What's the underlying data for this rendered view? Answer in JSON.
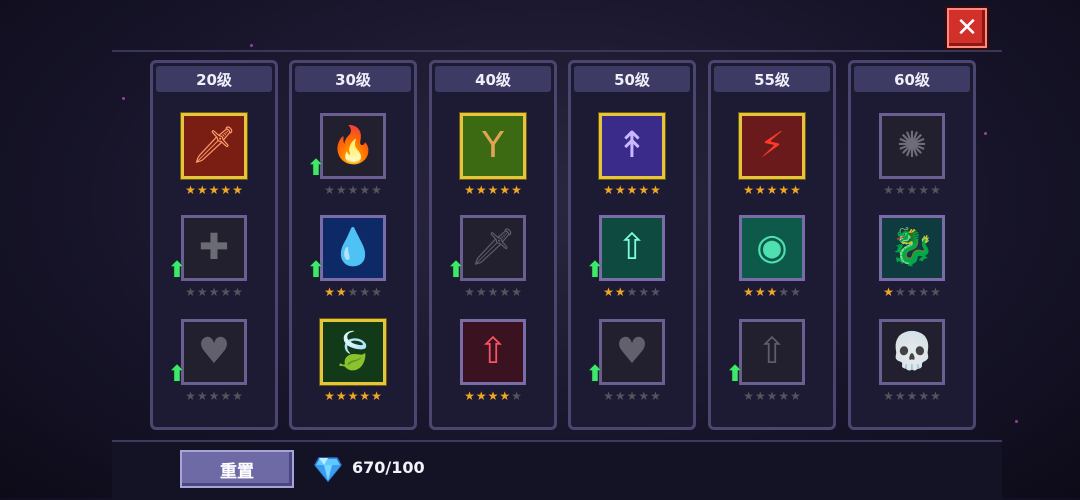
{
  "columns": [
    {
      "level": "20级",
      "skills": [
        {
          "icon": "sword-icon",
          "glyph": "🗡",
          "color": "#ff9a6a",
          "bg": "#7a1e14",
          "gold": true,
          "stars": 5,
          "up": false
        },
        {
          "icon": "shield-cross-icon",
          "glyph": "✚",
          "color": "#6b6b74",
          "bg": "#22202f",
          "gold": false,
          "stars": 0,
          "up": true
        },
        {
          "icon": "heart-icon",
          "glyph": "♥",
          "color": "#62606c",
          "bg": "#22202f",
          "gold": false,
          "stars": 0,
          "up": true
        }
      ]
    },
    {
      "level": "30级",
      "skills": [
        {
          "icon": "fire-drop-icon",
          "glyph": "🔥",
          "color": "#55535e",
          "bg": "#22202f",
          "gold": false,
          "stars": 0,
          "up": true
        },
        {
          "icon": "water-drop-icon",
          "glyph": "💧",
          "color": "#4aa8ff",
          "bg": "#0e2a66",
          "gold": false,
          "stars": 2,
          "up": true
        },
        {
          "icon": "leaf-icon",
          "glyph": "🍃",
          "color": "#47c95a",
          "bg": "#123a18",
          "gold": true,
          "stars": 5,
          "up": false
        }
      ]
    },
    {
      "level": "40级",
      "skills": [
        {
          "icon": "slingshot-icon",
          "glyph": "Y",
          "color": "#e0a457",
          "bg": "#3c6a12",
          "gold": true,
          "stars": 5,
          "up": false
        },
        {
          "icon": "dagger-icon",
          "glyph": "🗡",
          "color": "#5e5c68",
          "bg": "#22202f",
          "gold": false,
          "stars": 0,
          "up": true
        },
        {
          "icon": "crystal-sword-icon",
          "glyph": "⇧",
          "color": "#ff5060",
          "bg": "#3a1220",
          "gold": false,
          "stars": 4,
          "up": false
        }
      ]
    },
    {
      "level": "50级",
      "skills": [
        {
          "icon": "arrows-rain-icon",
          "glyph": "↟",
          "color": "#c9b8ff",
          "bg": "#3a2a8a",
          "gold": true,
          "stars": 5,
          "up": false
        },
        {
          "icon": "arrow-up-icon",
          "glyph": "⇧",
          "color": "#7affd8",
          "bg": "#0e4a40",
          "gold": false,
          "stars": 2,
          "up": true
        },
        {
          "icon": "heart-icon",
          "glyph": "♥",
          "color": "#62606c",
          "bg": "#22202f",
          "gold": false,
          "stars": 0,
          "up": true
        }
      ]
    },
    {
      "level": "55级",
      "skills": [
        {
          "icon": "lightning-icon",
          "glyph": "⚡",
          "color": "#ff3a2a",
          "bg": "#6a1a1a",
          "gold": true,
          "stars": 5,
          "up": false
        },
        {
          "icon": "vortex-icon",
          "glyph": "◉",
          "color": "#4fe0b0",
          "bg": "#0e5a4a",
          "gold": false,
          "stars": 3,
          "up": false
        },
        {
          "icon": "arrow-up-icon",
          "glyph": "⇧",
          "color": "#5e5c68",
          "bg": "#22202f",
          "gold": false,
          "stars": 0,
          "up": true
        }
      ]
    },
    {
      "level": "60级",
      "skills": [
        {
          "icon": "radiant-dome-icon",
          "glyph": "✺",
          "color": "#6e6c76",
          "bg": "#22202f",
          "gold": false,
          "stars": 0,
          "up": false
        },
        {
          "icon": "dragon-icon",
          "glyph": "🐉",
          "color": "#3ad0a0",
          "bg": "#0e3a40",
          "gold": false,
          "stars": 1,
          "up": false
        },
        {
          "icon": "skull-icon",
          "glyph": "💀",
          "color": "#6e6c76",
          "bg": "#22202f",
          "gold": false,
          "stars": 0,
          "up": false
        }
      ]
    }
  ],
  "footer": {
    "reset_label": "重置",
    "gem_icon": "diamond-icon",
    "gem_count": "670/100"
  },
  "close_icon": "close-icon"
}
